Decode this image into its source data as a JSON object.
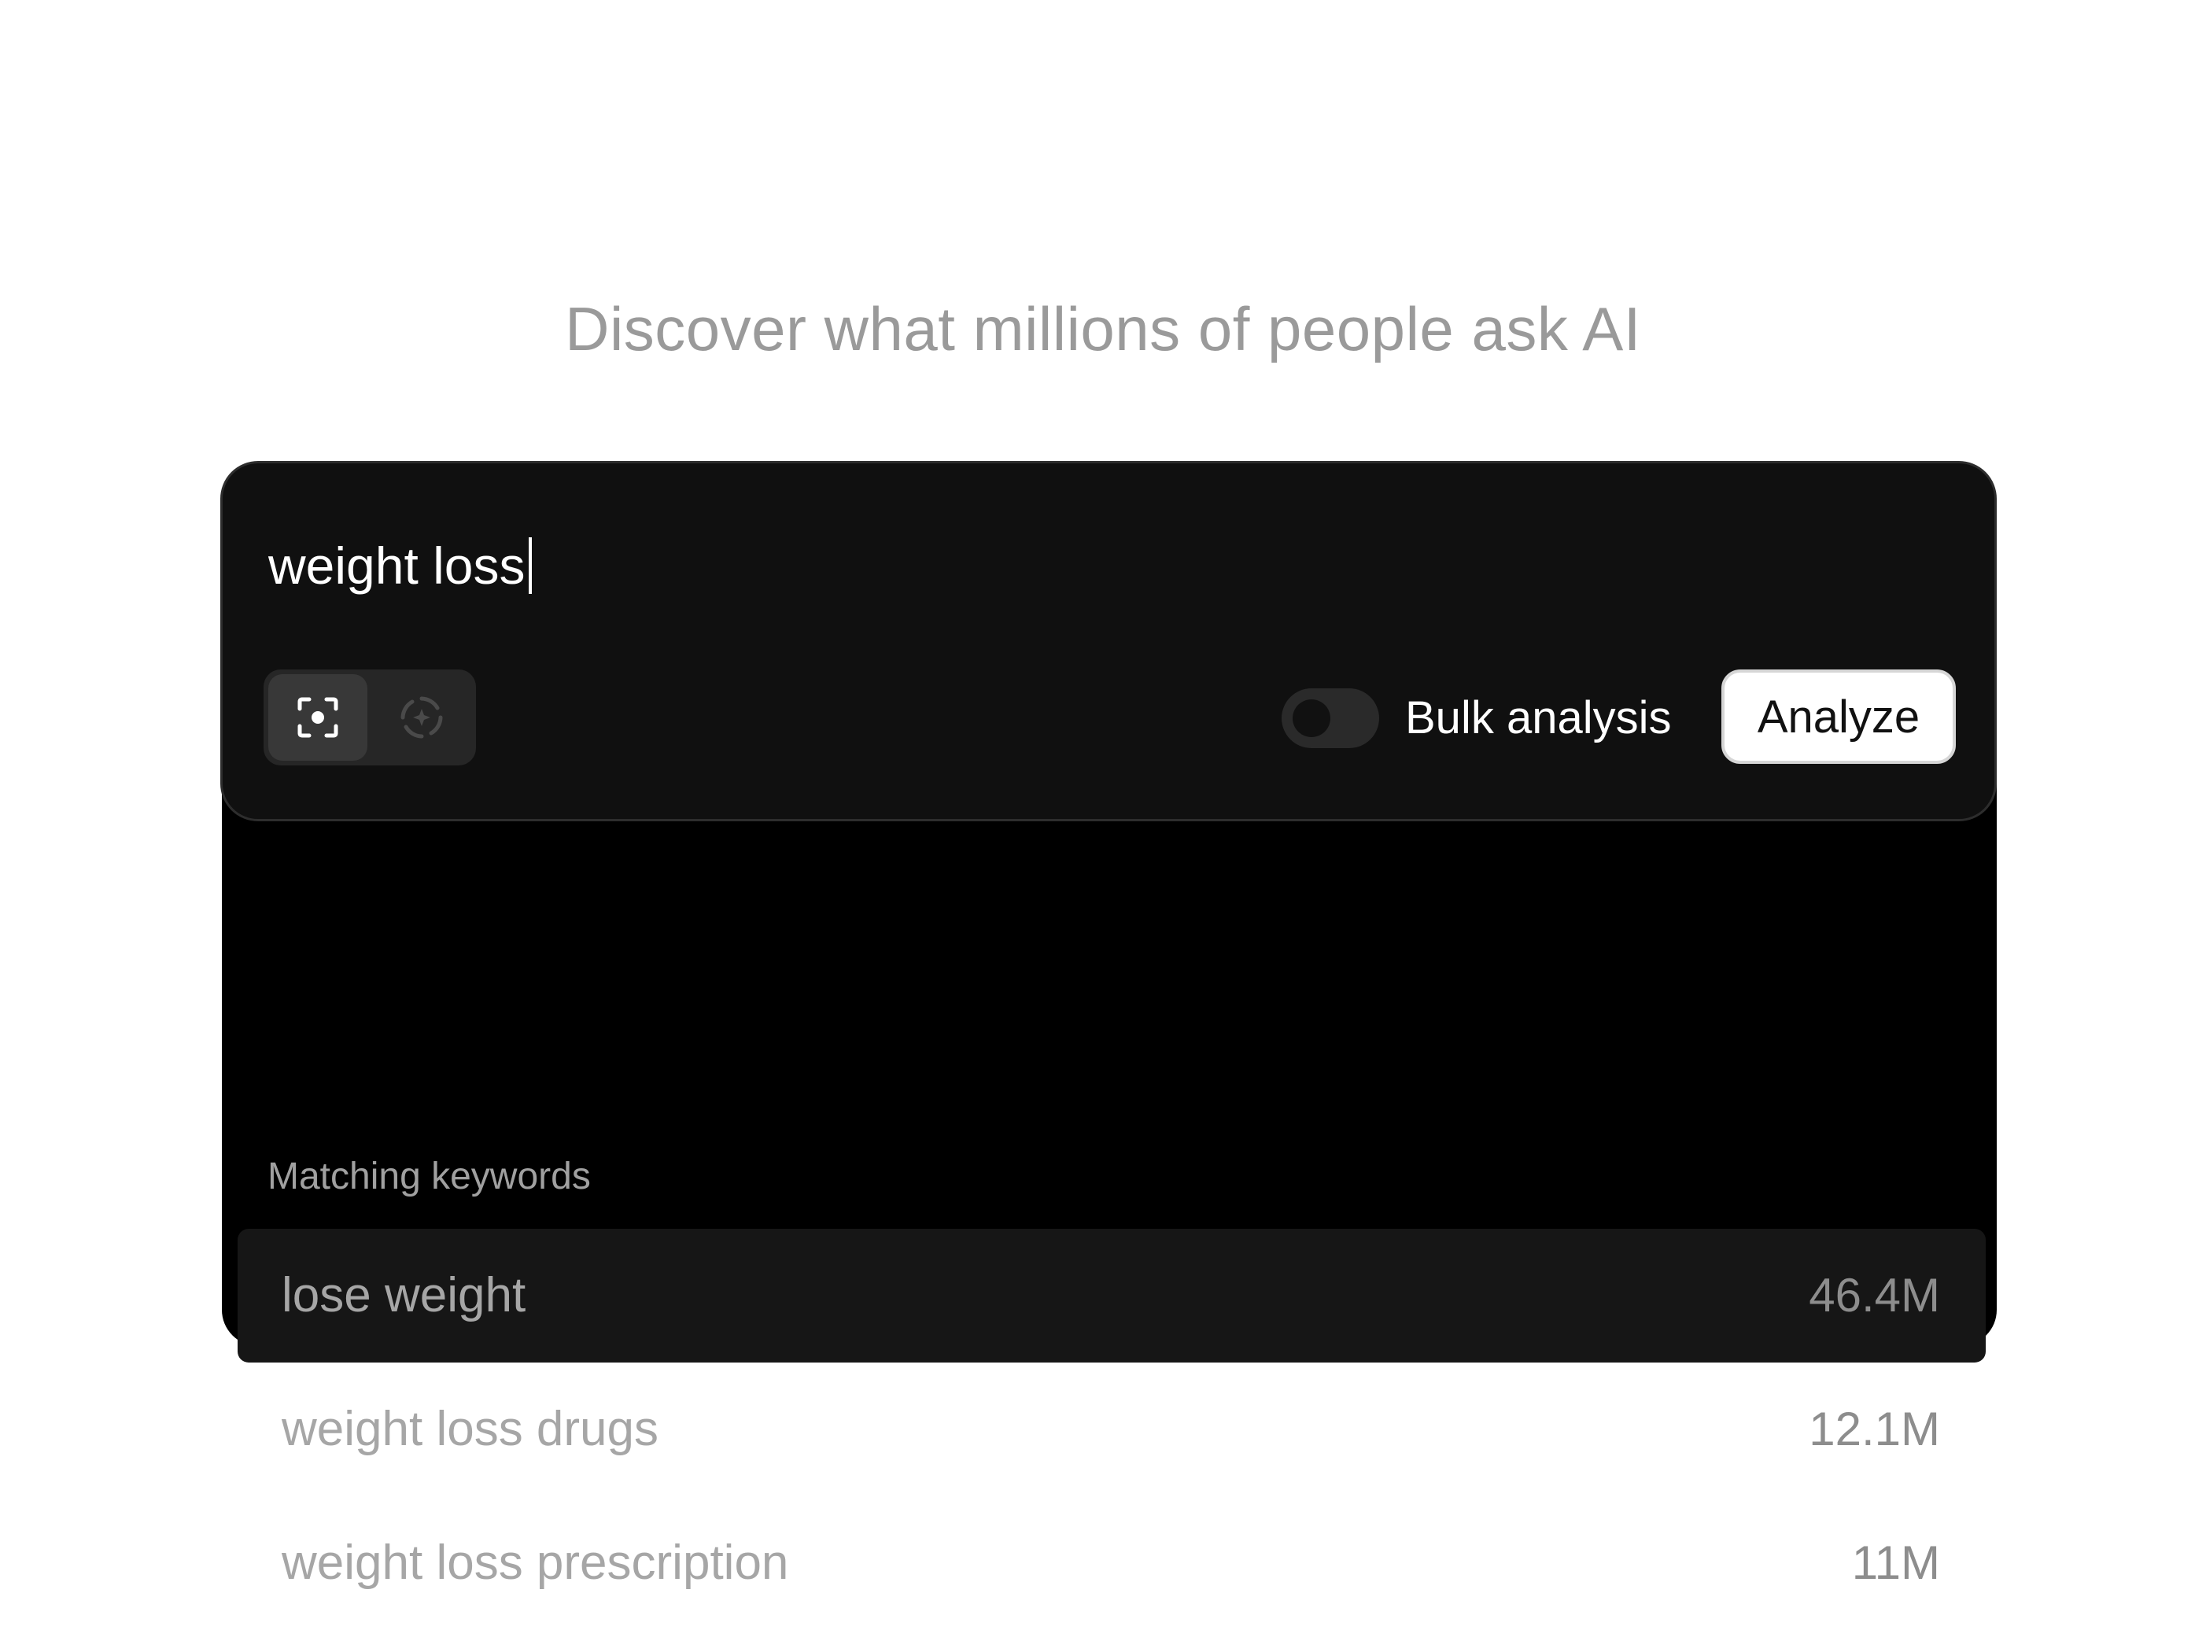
{
  "headline": "Discover what millions of people ask AI",
  "search": {
    "query": "weight loss",
    "modes": [
      {
        "icon": "focus-target-icon",
        "active": true
      },
      {
        "icon": "sparkle-ring-icon",
        "active": false
      }
    ],
    "bulk_analysis": {
      "label": "Bulk analysis",
      "enabled": false
    },
    "analyze_label": "Analyze"
  },
  "results": {
    "heading": "Matching keywords",
    "keywords": [
      {
        "text": "lose weight",
        "count": "46.4M",
        "highlighted": true
      },
      {
        "text": "weight loss drugs",
        "count": "12.1M",
        "highlighted": false
      },
      {
        "text": "weight loss prescription",
        "count": "11M",
        "highlighted": false
      }
    ]
  }
}
